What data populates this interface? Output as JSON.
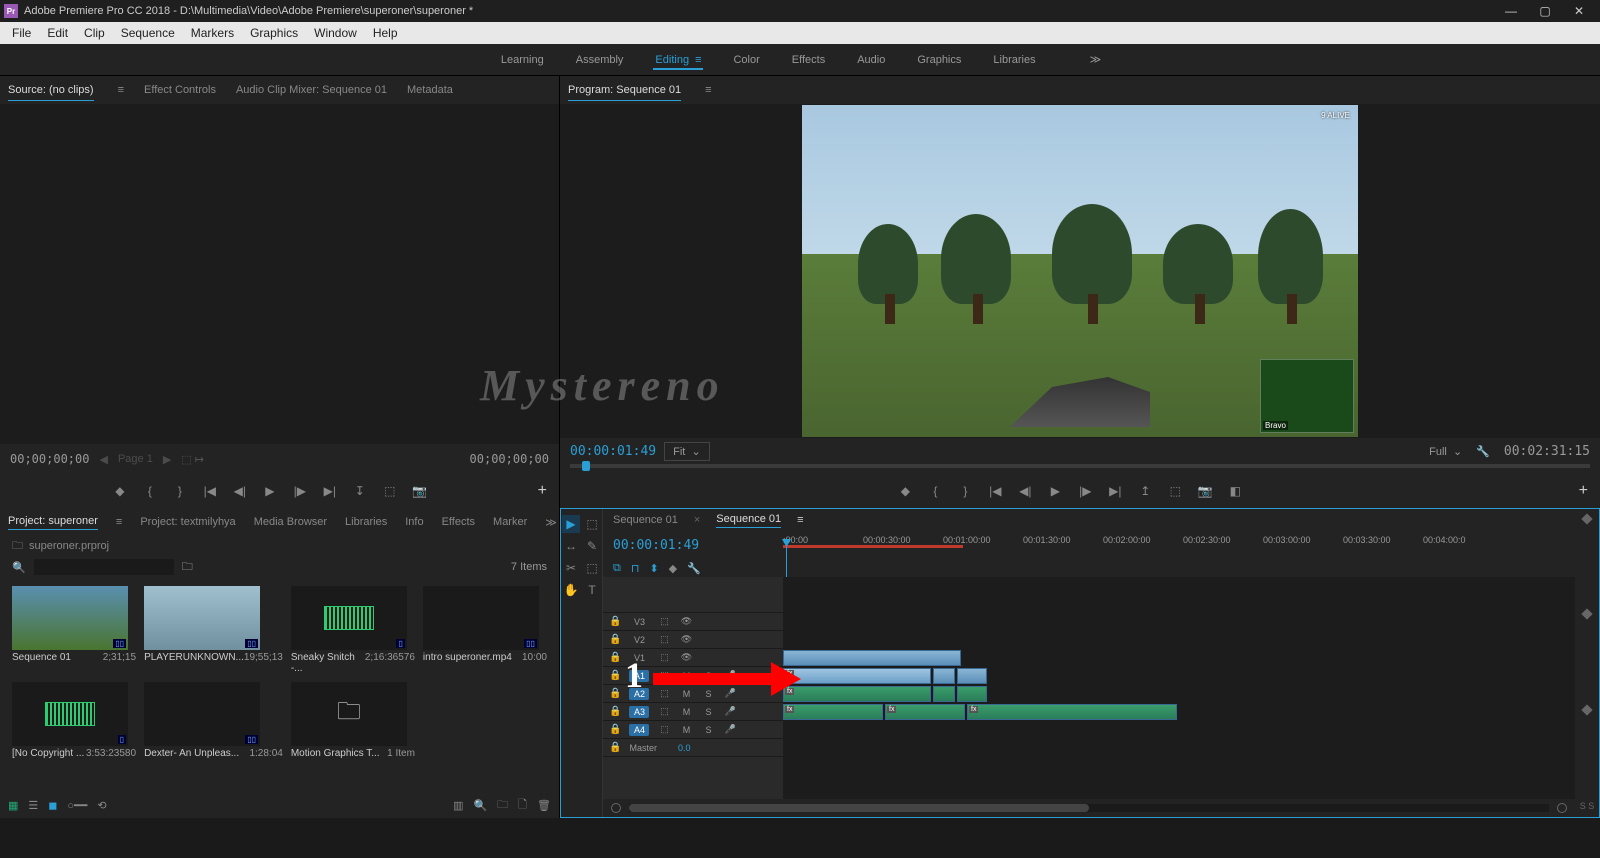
{
  "titlebar": {
    "title": "Adobe Premiere Pro CC 2018 - D:\\Multimedia\\Video\\Adobe Premiere\\superoner\\superoner *"
  },
  "menubar": [
    "File",
    "Edit",
    "Clip",
    "Sequence",
    "Markers",
    "Graphics",
    "Window",
    "Help"
  ],
  "workspaces": {
    "items": [
      "Learning",
      "Assembly",
      "Editing",
      "Color",
      "Effects",
      "Audio",
      "Graphics",
      "Libraries"
    ],
    "active_index": 2
  },
  "source_panel": {
    "tabs": [
      "Source: (no clips)",
      "Effect Controls",
      "Audio Clip Mixer: Sequence 01",
      "Metadata"
    ],
    "active_index": 0,
    "tc_left": "00;00;00;00",
    "page_label": "Page 1",
    "tc_right": "00;00;00;00"
  },
  "program_panel": {
    "tab": "Program: Sequence 01",
    "tc": "00:00:01:49",
    "fit": "Fit",
    "full": "Full",
    "duration": "00:02:31:15",
    "hud_alive": "9 ALIVE",
    "minimap_label": "Bravo"
  },
  "project_panel": {
    "tabs": [
      "Project: superoner",
      "Project: textmilyhya",
      "Media Browser",
      "Libraries",
      "Info",
      "Effects",
      "Marker"
    ],
    "active_index": 0,
    "path": "superoner.prproj",
    "item_count": "7 Items",
    "footer_item": "1 Item",
    "items": [
      {
        "name": "Sequence 01",
        "dur": "2;31;15",
        "thumb": "vid"
      },
      {
        "name": "PLAYERUNKNOWN...",
        "dur": "19;55;13",
        "thumb": "vid2"
      },
      {
        "name": "Sneaky Snitch -...",
        "dur": "2;16:36576",
        "thumb": "wave"
      },
      {
        "name": "intro superoner.mp4",
        "dur": "10:00",
        "thumb": "black"
      },
      {
        "name": "[No Copyright ...",
        "dur": "3:53:23580",
        "thumb": "wave"
      },
      {
        "name": "Dexter- An Unpleas...",
        "dur": "1:28:04",
        "thumb": "black"
      },
      {
        "name": "Motion Graphics T...",
        "dur": "",
        "thumb": "folder"
      }
    ]
  },
  "timeline": {
    "tabs": [
      "Sequence 01",
      "Sequence 01"
    ],
    "active_index": 1,
    "tc": "00:00:01:49",
    "ruler": [
      ":00:00",
      "00:00:30:00",
      "00:01:00:00",
      "00:01:30:00",
      "00:02:00:00",
      "00:02:30:00",
      "00:03:00:00",
      "00:03:30:00",
      "00:04:00:0"
    ],
    "tracks_v": [
      "V3",
      "V2",
      "V1"
    ],
    "tracks_a": [
      "A1",
      "A2",
      "A3",
      "A4"
    ],
    "master": "Master",
    "master_val": "0.0"
  },
  "watermark": "Mystereno",
  "annotation": {
    "number": "1"
  }
}
